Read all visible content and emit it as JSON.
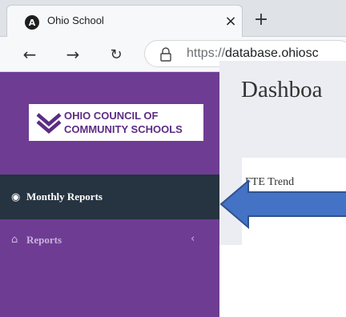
{
  "browser": {
    "tab_title": "Ohio School",
    "tab_favicon": "A",
    "tab_close": "×",
    "new_tab": "+",
    "url_prefix": "https://",
    "url_host": "database.ohiosc",
    "icons": [
      "back-arrow-icon",
      "forward-arrow-icon",
      "reload-icon",
      "lock-icon"
    ]
  },
  "sidebar": {
    "logo_line1": "OHIO COUNCIL OF",
    "logo_line2": "COMMUNITY SCHOOLS",
    "items": [
      {
        "label": "Monthly Reports",
        "icon": "dashboard-icon",
        "glyph": "◉",
        "active": true
      },
      {
        "label": "Reports",
        "icon": "bank-icon",
        "glyph": "⌂",
        "chevron": "‹",
        "active": false
      }
    ]
  },
  "header": {
    "logo_letters_1": "O",
    "logo_letters_2": "C"
  },
  "main": {
    "page_title": "Dashboa",
    "panel_title": "FTE Trend"
  },
  "colors": {
    "sidebar_bg": "#6f3c94",
    "active_item_bg": "#263340",
    "brand_purple": "#5c2c83",
    "arrow_fill": "#4472c4"
  }
}
